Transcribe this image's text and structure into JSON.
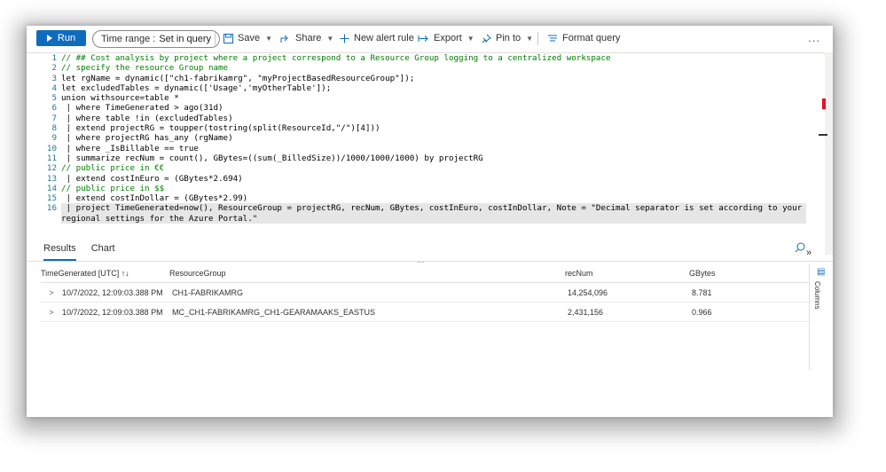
{
  "toolbar": {
    "run_label": "Run",
    "time_range_label": "Time range :",
    "time_range_value": "Set in query",
    "save_label": "Save",
    "share_label": "Share",
    "new_alert_label": "New alert rule",
    "export_label": "Export",
    "pin_label": "Pin to",
    "format_label": "Format query",
    "more_label": "..."
  },
  "editor": {
    "line_numbers": [
      "1",
      "2",
      "3",
      "4",
      "5",
      "6",
      "7",
      "8",
      "9",
      "10",
      "11",
      "12",
      "13",
      "14",
      "15",
      "16",
      ""
    ],
    "lines": [
      "// ## Cost analysis by project where a project correspond to a Resource Group logging to a centralized workspace",
      "// specify the resource Group name",
      "let rgName = dynamic([\"ch1-fabrikamrg\", \"myProjectBasedResourceGroup\"]);",
      "let excludedTables = dynamic(['Usage','myOtherTable']);",
      "union withsource=table *",
      " | where TimeGenerated > ago(31d)",
      " | where table !in (excludedTables)",
      " | extend projectRG = toupper(tostring(split(ResourceId,\"/\")[4]))",
      " | where projectRG has_any (rgName)",
      " | where _IsBillable == true",
      " | summarize recNum = count(), GBytes=((sum(_BilledSize))/1000/1000/1000) by projectRG",
      "// public price in €€",
      " | extend costInEuro = (GBytes*2.694)",
      "// public price in $$",
      " | extend costInDollar = (GBytes*2.99)",
      " | project TimeGenerated=now(), ResourceGroup = projectRG, recNum, GBytes, costInEuro, costInDollar, Note = \"Decimal separator is set according to your",
      "regional settings for the Azure Portal.\""
    ],
    "grip": "...",
    "collapse": "»"
  },
  "results": {
    "tabs": [
      {
        "label": "Results"
      },
      {
        "label": "Chart"
      }
    ],
    "columns": [
      "TimeGenerated [UTC]",
      "ResourceGroup",
      "recNum",
      "GBytes"
    ],
    "sort_indicator": "↑↓",
    "rows": [
      {
        "expand": ">",
        "time": "10/7/2022, 12:09:03.388 PM",
        "rg": "CH1-FABRIKAMRG",
        "recnum": "14,254,096",
        "gbytes": "8.781"
      },
      {
        "expand": ">",
        "time": "10/7/2022, 12:09:03.388 PM",
        "rg": "MC_CH1-FABRIKAMRG_CH1-GEARAMAAKS_EASTUS",
        "recnum": "2,431,156",
        "gbytes": "0.966"
      }
    ],
    "columns_panel_label": "Columns"
  },
  "icons": {
    "run": "play-icon",
    "save": "save-icon",
    "share": "share-icon",
    "alert": "plus-icon",
    "export": "export-icon",
    "pin": "pin-icon",
    "format": "format-icon",
    "search": "search-icon"
  },
  "colors": {
    "accent": "#0f6cbd",
    "comment": "#008000",
    "linenumber": "#237893"
  }
}
